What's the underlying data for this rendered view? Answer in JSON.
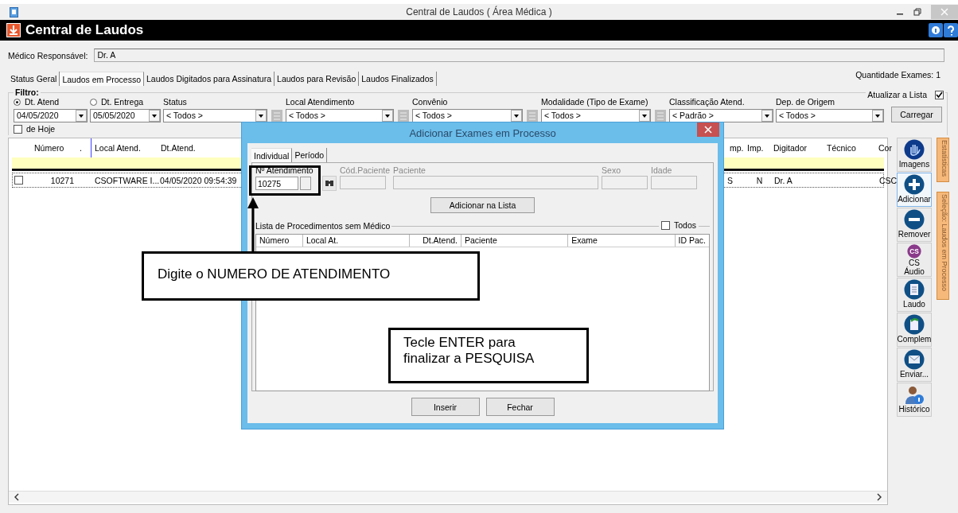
{
  "window": {
    "title": "Central de Laudos ( Área Médica )"
  },
  "header": {
    "title": "Central de Laudos"
  },
  "doctor": {
    "label": "Médico Responsável:",
    "value": "Dr. A"
  },
  "tabs": [
    {
      "label": "Status Geral",
      "selected": false
    },
    {
      "label": "Laudos em Processo",
      "selected": true
    },
    {
      "label": "Laudos Digitados para Assinatura",
      "selected": false
    },
    {
      "label": "Laudos para Revisão",
      "selected": false
    },
    {
      "label": "Laudos Finalizados",
      "selected": false
    }
  ],
  "exam_count": "Quantidade Exames: 1",
  "filter": {
    "title": "Filtro:",
    "fields": [
      {
        "kind": "date",
        "label": "Dt. Atend",
        "selected": true,
        "value": "04/05/2020",
        "lookup": false
      },
      {
        "kind": "date",
        "label": "Dt. Entrega",
        "selected": false,
        "value": "05/05/2020",
        "lookup": false
      },
      {
        "kind": "combo",
        "label": "Status",
        "value": "< Todos >",
        "lookup": true
      },
      {
        "kind": "combo",
        "label": "Local Atendimento",
        "value": "< Todos >",
        "lookup": true
      },
      {
        "kind": "combo",
        "label": "Convênio",
        "value": "< Todos >",
        "lookup": true
      },
      {
        "kind": "combo",
        "label": "Modalidade (Tipo de Exame)",
        "value": "< Todos >",
        "lookup": true
      },
      {
        "kind": "combo",
        "label": "Classificação Atend.",
        "value": "< Padrão >",
        "lookup": false
      },
      {
        "kind": "combo",
        "label": "Dep. de Origem",
        "value": "< Todos >",
        "lookup": false
      }
    ],
    "today": {
      "label": "de Hoje",
      "checked": false
    },
    "refresh": {
      "label": "Atualizar a Lista",
      "checked": true
    },
    "load_button": "Carregar"
  },
  "grid": {
    "columns": [
      "Número",
      ".",
      "Local Atend.",
      "Dt.Atend.",
      "mp.",
      "Imp.",
      "Digitador",
      "Técnico",
      "Cor"
    ],
    "rows": [
      {
        "checked": false,
        "cells": [
          "10271",
          "",
          "CSOFTWARE I...",
          "04/05/2020 09:54:39",
          "S",
          "N",
          "Dr. A",
          "",
          "CSC"
        ]
      }
    ]
  },
  "toolbar": [
    {
      "kind": "hand",
      "label": "Imagens",
      "selected": false
    },
    {
      "kind": "plus",
      "label": "Adicionar",
      "selected": true
    },
    {
      "kind": "minus",
      "label": "Remover",
      "selected": false
    },
    {
      "kind": "badge",
      "badge": "CS",
      "label": "CS Áudio",
      "selected": false
    },
    {
      "kind": "document",
      "label": "Laudo",
      "selected": false
    },
    {
      "kind": "document-arrow",
      "label": "Complem",
      "selected": false
    },
    {
      "kind": "envelope",
      "label": "Enviar...",
      "selected": false
    },
    {
      "kind": "person",
      "label": "Histórico",
      "selected": false
    }
  ],
  "side_tabs": [
    "Estatísticas",
    "Seleção: Laudos em Processo"
  ],
  "dialog": {
    "title": "Adicionar Exames em Processo",
    "tabs": [
      {
        "label": "Individual",
        "selected": true
      },
      {
        "label": "Período",
        "selected": false
      }
    ],
    "fields": [
      {
        "label": "Nº Atendimento",
        "value": "10275",
        "disabled": false
      },
      {
        "label": "Cód.Paciente",
        "disabled": true
      },
      {
        "label": "Paciente",
        "disabled": true
      },
      {
        "label": "Sexo",
        "disabled": true
      },
      {
        "label": "Idade",
        "disabled": true
      }
    ],
    "add_button": "Adicionar na Lista",
    "group_title": "Lista de Procedimentos sem Médico",
    "all": {
      "label": "Todos",
      "checked": false
    },
    "columns": [
      "Número",
      "Local At.",
      "Dt.Atend.",
      "Paciente",
      "Exame",
      "ID Pac."
    ],
    "buttons": [
      "Inserir",
      "Fechar"
    ]
  },
  "annotations": [
    "Digite o NUMERO DE ATENDIMENTO",
    "Tecle ENTER para finalizar a PESQUISA"
  ]
}
